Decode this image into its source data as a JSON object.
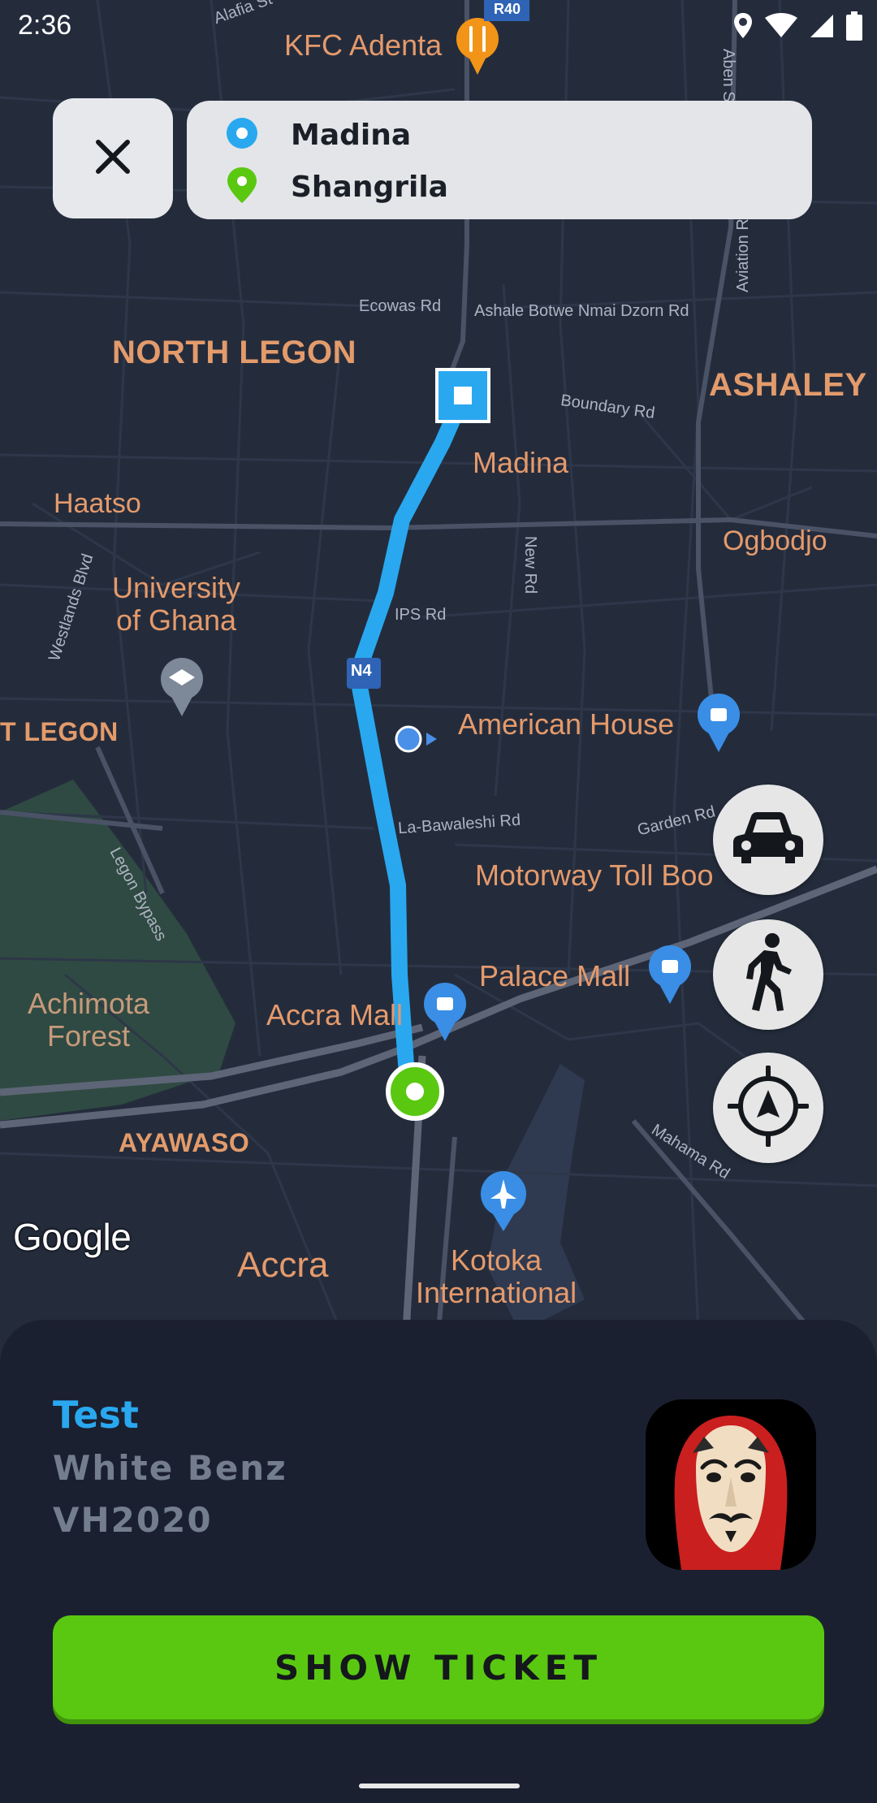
{
  "status_bar": {
    "time": "2:36",
    "icons": [
      "location-icon",
      "wifi-icon",
      "signal-icon",
      "battery-icon"
    ]
  },
  "route": {
    "origin": "Madina",
    "destination": "Shangrila",
    "origin_color": "#29a8f0",
    "destination_color": "#5ac811"
  },
  "map": {
    "districts": [
      "NORTH LEGON",
      "ASHALEY",
      "AYAWASO",
      "T LEGON"
    ],
    "places": {
      "kfc": "KFC Adenta",
      "madina": "Madina",
      "haatso": "Haatso",
      "ogbodjo": "Ogbodjo",
      "university": [
        "University",
        "of Ghana"
      ],
      "american_house": "American House",
      "motorway_toll": "Motorway Toll Boo",
      "palace_mall": "Palace Mall",
      "accra_mall": "Accra Mall",
      "achimota": [
        "Achimota",
        "Forest"
      ],
      "accra": "Accra",
      "kotoka": [
        "Kotoka",
        "International"
      ]
    },
    "streets": {
      "alafia": "Alafia St",
      "ecowas": "Ecowas Rd",
      "ashale_botwe": "Ashale Botwe Nmai Dzorn Rd",
      "boundary": "Boundary Rd",
      "ips": "IPS Rd",
      "new_rd": "New Rd",
      "westlands": "Westlands Blvd",
      "la_bawaleshi": "La-Bawaleshi Rd",
      "garden": "Garden Rd",
      "legon_bypass": "Legon Bypass",
      "mahama": "Mahama Rd",
      "aviation": "Aviation Rd",
      "aben": "Aben St"
    },
    "shields": {
      "n4": "N4",
      "r40": "R40"
    },
    "route_color": "#29a8f0",
    "attribution": "Google"
  },
  "modes": [
    "car-icon",
    "walk-icon",
    "recenter-icon"
  ],
  "driver": {
    "name": "Test",
    "car_model": "White Benz",
    "plate": "VH2020"
  },
  "actions": {
    "show_ticket": "SHOW TICKET"
  }
}
